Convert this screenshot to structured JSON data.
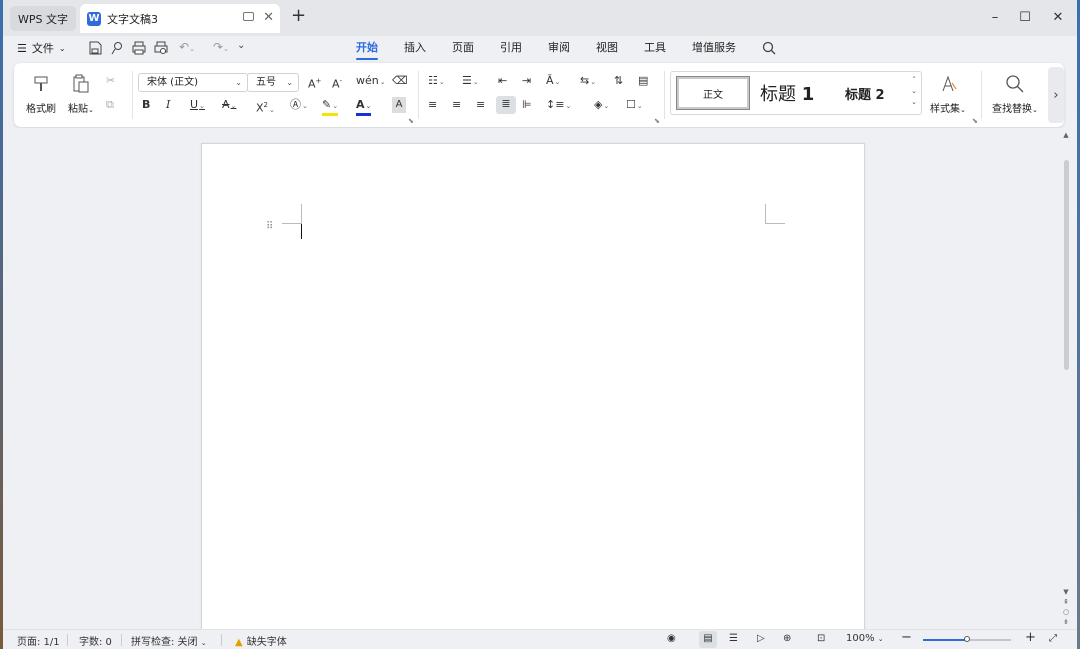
{
  "titlebar": {
    "home_tab": "WPS 文字",
    "doc_tab_icon": "W",
    "doc_tab_title": "文字文稿3",
    "new_tab": "+",
    "minimize": "–",
    "maximize": "☐",
    "close": "✕"
  },
  "menu": {
    "file_label": "文件",
    "tabs": [
      {
        "label": "开始",
        "active": true
      },
      {
        "label": "插入",
        "active": false
      },
      {
        "label": "页面",
        "active": false
      },
      {
        "label": "引用",
        "active": false
      },
      {
        "label": "审阅",
        "active": false
      },
      {
        "label": "视图",
        "active": false
      },
      {
        "label": "工具",
        "active": false
      },
      {
        "label": "增值服务",
        "active": false
      }
    ]
  },
  "ribbon": {
    "format_painter": "格式刷",
    "paste": "粘贴",
    "font_name": "宋体 (正文)",
    "font_size": "五号",
    "styles": {
      "normal": "正文",
      "heading1": "标题",
      "heading1_num": "1",
      "heading2": "标题",
      "heading2_num": "2"
    },
    "style_set": "样式集",
    "find_replace": "查找替换"
  },
  "statusbar": {
    "page": "页面: 1/1",
    "word_count": "字数: 0",
    "spell_check": "拼写检查: 关闭",
    "missing_font": "缺失字体",
    "zoom": "100%",
    "zoom_level": 0.5
  },
  "colors": {
    "accent": "#2f6bdb",
    "highlight": "#f2e600",
    "font_color": "#1a2fd6"
  }
}
